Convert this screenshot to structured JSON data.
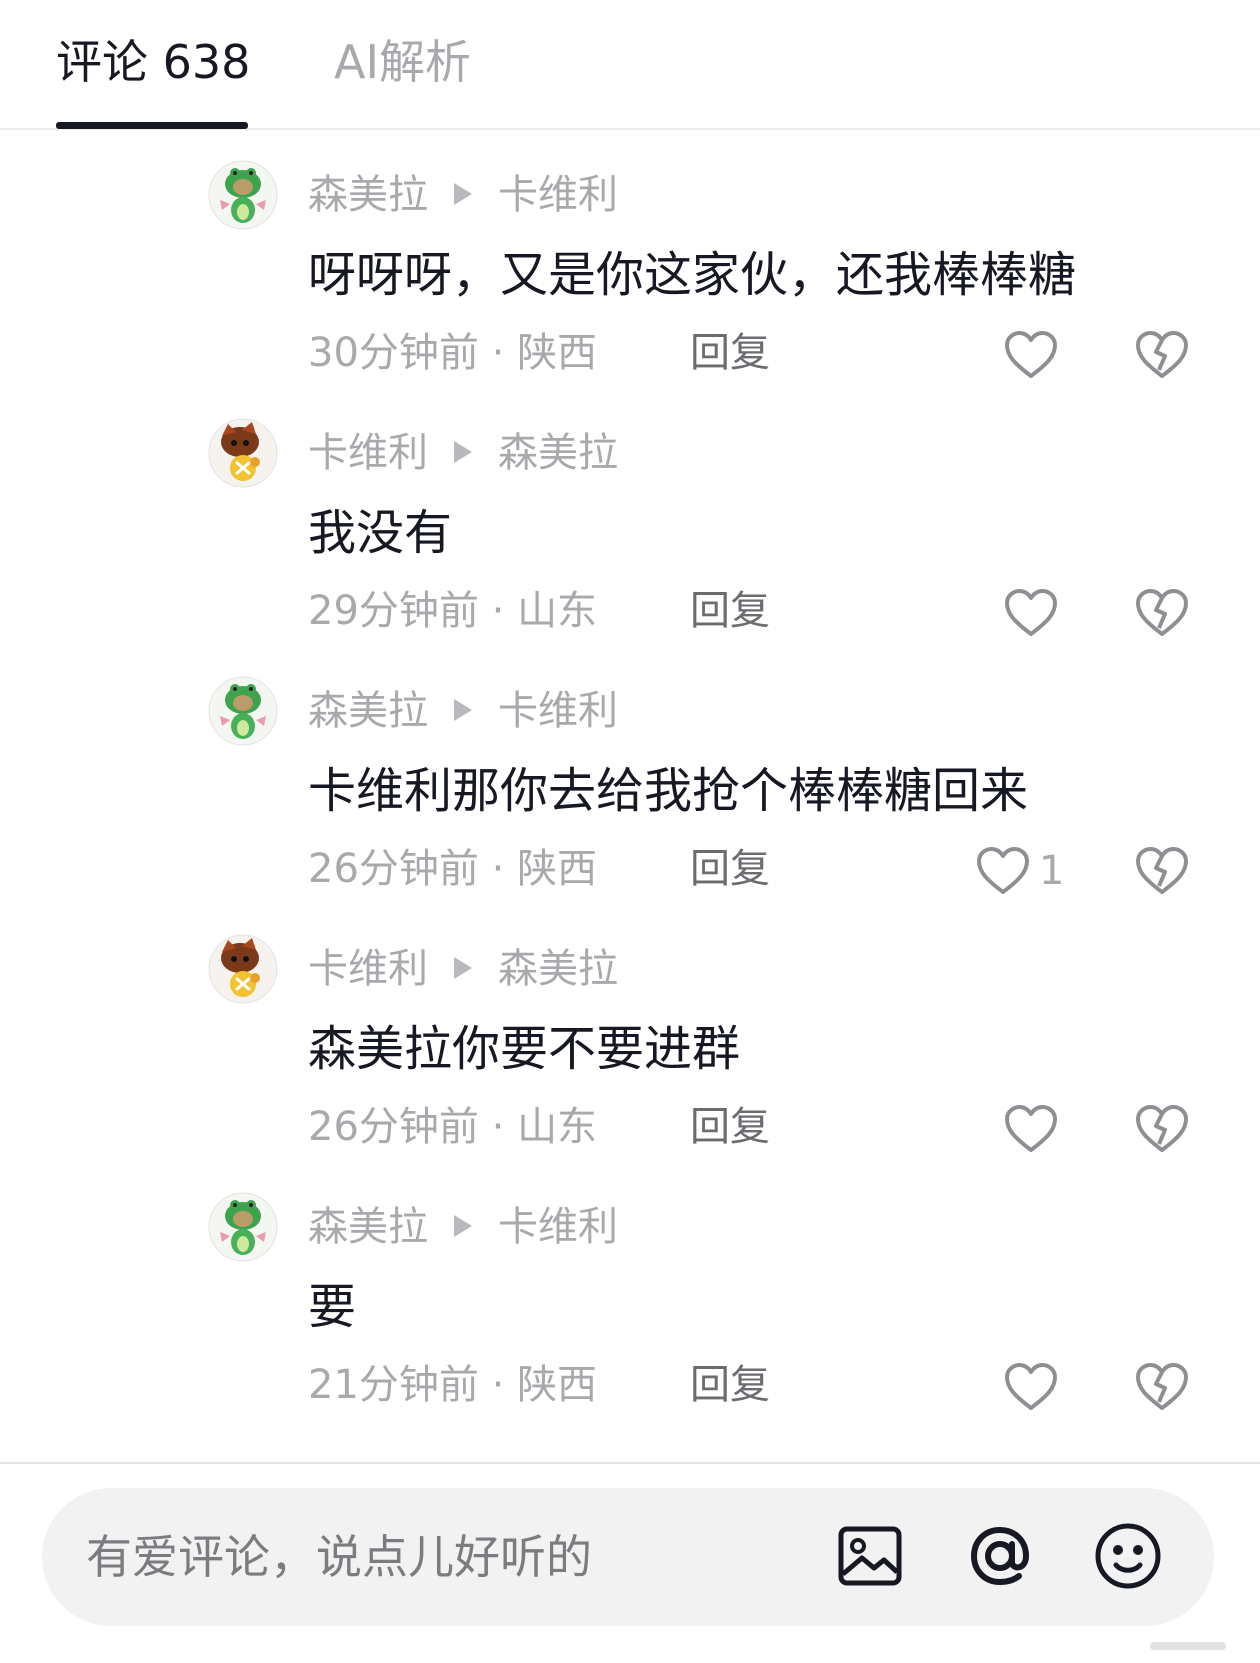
{
  "tabs": [
    {
      "label": "评论 638",
      "active": true
    },
    {
      "label": "AI解析",
      "active": false
    }
  ],
  "comments": [
    {
      "author": "森美拉",
      "reply_to": "卡维利",
      "text": "呀呀呀，又是你这家伙，还我棒棒糖",
      "time": "30分钟前",
      "location": "陕西",
      "reply_label": "回复",
      "likes": "",
      "avatar": "green-frog-avatar"
    },
    {
      "author": "卡维利",
      "reply_to": "森美拉",
      "text": "我没有",
      "time": "29分钟前",
      "location": "山东",
      "reply_label": "回复",
      "likes": "",
      "avatar": "brown-bear-avatar"
    },
    {
      "author": "森美拉",
      "reply_to": "卡维利",
      "text": "卡维利那你去给我抢个棒棒糖回来",
      "time": "26分钟前",
      "location": "陕西",
      "reply_label": "回复",
      "likes": "1",
      "avatar": "green-frog-avatar"
    },
    {
      "author": "卡维利",
      "reply_to": "森美拉",
      "text": "森美拉你要不要进群",
      "time": "26分钟前",
      "location": "山东",
      "reply_label": "回复",
      "likes": "",
      "avatar": "brown-bear-avatar"
    },
    {
      "author": "森美拉",
      "reply_to": "卡维利",
      "text": "要",
      "time": "21分钟前",
      "location": "陕西",
      "reply_label": "回复",
      "likes": "",
      "avatar": "green-frog-avatar"
    }
  ],
  "meta_separator": " · ",
  "input": {
    "placeholder": "有爱评论，说点儿好听的"
  },
  "toolbar_icons": [
    "image-icon",
    "at-icon",
    "emoji-icon"
  ],
  "colors": {
    "text": "#161823",
    "muted": "#a8a9ad",
    "reply": "#6b6c70",
    "input_bg": "#f2f2f3"
  }
}
